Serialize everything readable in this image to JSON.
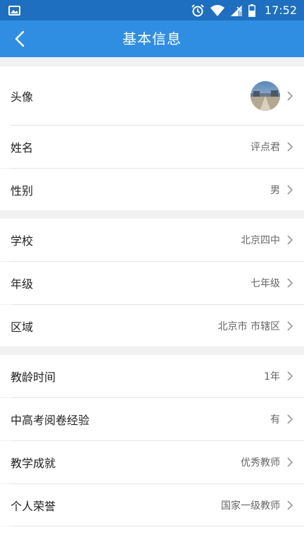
{
  "status_bar": {
    "time": "17:52",
    "icons": [
      "image-icon",
      "alarm-icon",
      "wifi-icon",
      "signal-icon",
      "battery-icon"
    ]
  },
  "app_bar": {
    "title": "基本信息",
    "back_icon": "back-arrow-icon"
  },
  "colors": {
    "status_bar": "#1e6fbf",
    "app_bar": "#2f8ee2",
    "background": "#f1f1f1",
    "row": "#ffffff"
  },
  "sections": [
    {
      "rows": [
        {
          "label": "头像",
          "value": "",
          "type": "avatar"
        },
        {
          "label": "姓名",
          "value": "评点君"
        },
        {
          "label": "性别",
          "value": "男"
        }
      ]
    },
    {
      "rows": [
        {
          "label": "学校",
          "value": "北京四中"
        },
        {
          "label": "年级",
          "value": "七年级"
        },
        {
          "label": "区域",
          "value": "北京市 市辖区"
        }
      ]
    },
    {
      "rows": [
        {
          "label": "教龄时间",
          "value": "1年"
        },
        {
          "label": "中高考阅卷经验",
          "value": "有"
        },
        {
          "label": "教学成就",
          "value": "优秀教师"
        },
        {
          "label": "个人荣誉",
          "value": "国家一级教师"
        }
      ]
    }
  ]
}
